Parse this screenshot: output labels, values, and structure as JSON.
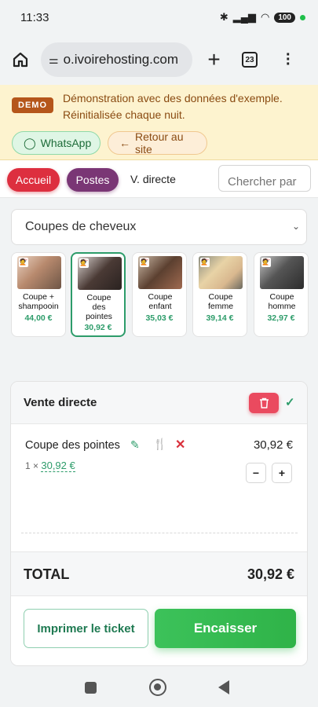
{
  "status_bar": {
    "time": "11:33",
    "battery": "100"
  },
  "browser": {
    "url": "o.ivoirehosting.com",
    "tab_count": "23"
  },
  "demo_banner": {
    "badge": "DEMO",
    "line1": "Démonstration avec des données d'exemple.",
    "line2": "Réinitialisée chaque nuit.",
    "whatsapp_label": "WhatsApp",
    "back_label": "Retour au site"
  },
  "nav": {
    "accueil": "Accueil",
    "postes": "Postes",
    "vente_directe": "V. directe",
    "search_placeholder": "Chercher par"
  },
  "category": {
    "selected": "Coupes de cheveux"
  },
  "products": [
    {
      "name": "Coupe + shampooin",
      "price": "44,00 €"
    },
    {
      "name": "Coupe des pointes",
      "price": "30,92 €",
      "selected": true
    },
    {
      "name": "Coupe enfant",
      "price": "35,03 €"
    },
    {
      "name": "Coupe femme",
      "price": "39,14 €"
    },
    {
      "name": "Coupe homme",
      "price": "32,97 €"
    }
  ],
  "sale": {
    "title": "Vente directe",
    "line": {
      "name": "Coupe des pointes",
      "qty_prefix": "1 ×",
      "unit_price": "30,92 €",
      "total": "30,92 €"
    },
    "total_label": "TOTAL",
    "total_value": "30,92 €",
    "print_label": "Imprimer le ticket",
    "pay_label": "Encaisser"
  },
  "colors": {
    "accent_green": "#2d9c6a",
    "accueil_red": "#dd2f3f",
    "postes_purple": "#7a3675",
    "demo_badge": "#b5561b"
  }
}
